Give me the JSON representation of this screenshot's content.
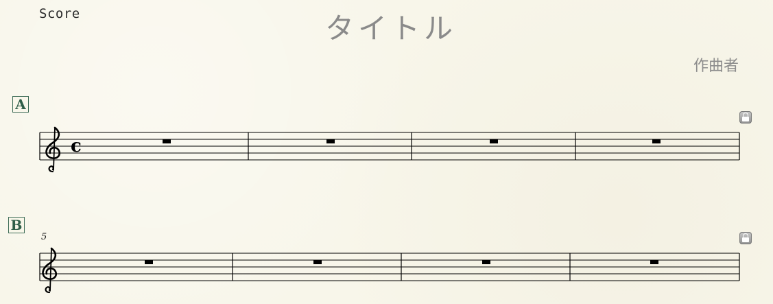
{
  "header": {
    "part_name": "Score",
    "title": "タイトル",
    "composer": "作曲者"
  },
  "systems": [
    {
      "rehearsal_mark": "A",
      "clef": "treble",
      "time_signature": "common-time",
      "time_signature_symbol": "c",
      "measure_number": "",
      "measures": [
        {
          "content": "whole-rest"
        },
        {
          "content": "whole-rest"
        },
        {
          "content": "whole-rest"
        },
        {
          "content": "whole-rest"
        }
      ],
      "locked": true
    },
    {
      "rehearsal_mark": "B",
      "clef": "treble",
      "time_signature": "",
      "measure_number": "5",
      "measures": [
        {
          "content": "whole-rest"
        },
        {
          "content": "whole-rest"
        },
        {
          "content": "whole-rest"
        },
        {
          "content": "whole-rest"
        }
      ],
      "locked": true
    }
  ],
  "colors": {
    "paper": "#f8f6ea",
    "rehearsal_mark": "#2f5e48",
    "title": "#8a8a8a",
    "ink": "#000000"
  }
}
